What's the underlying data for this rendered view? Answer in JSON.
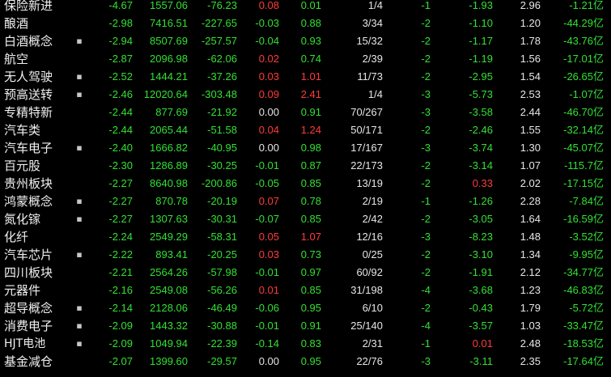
{
  "colors": {
    "up": "#ff3b3b",
    "down": "#33e033",
    "flat": "#e6e6e6",
    "background": "#000000"
  },
  "rows": [
    {
      "name": "保险新进",
      "mark": "",
      "pct": "-4.67",
      "index": "1557.06",
      "change": "-76.23",
      "speed": "0.08",
      "turnover": "0.01",
      "updown": "1/4",
      "lead": "-1",
      "lead_pct": "-1.93",
      "vol_ratio": "2.96",
      "flow": "-1.21",
      "flow_unit": "亿"
    },
    {
      "name": "酿酒",
      "mark": "",
      "pct": "-2.98",
      "index": "7416.51",
      "change": "-227.65",
      "speed": "-0.03",
      "turnover": "0.88",
      "updown": "3/34",
      "lead": "-2",
      "lead_pct": "-1.10",
      "vol_ratio": "1.20",
      "flow": "-44.29",
      "flow_unit": "亿"
    },
    {
      "name": "白酒概念",
      "mark": "▪",
      "pct": "-2.94",
      "index": "8507.69",
      "change": "-257.57",
      "speed": "-0.04",
      "turnover": "0.93",
      "updown": "15/32",
      "lead": "-2",
      "lead_pct": "-1.17",
      "vol_ratio": "1.78",
      "flow": "-43.76",
      "flow_unit": "亿"
    },
    {
      "name": "航空",
      "mark": "",
      "pct": "-2.87",
      "index": "2096.98",
      "change": "-62.06",
      "speed": "0.02",
      "turnover": "0.74",
      "updown": "2/39",
      "lead": "-2",
      "lead_pct": "-1.19",
      "vol_ratio": "1.56",
      "flow": "-17.01",
      "flow_unit": "亿"
    },
    {
      "name": "无人驾驶",
      "mark": "▪",
      "pct": "-2.52",
      "index": "1444.21",
      "change": "-37.26",
      "speed": "0.03",
      "turnover": "1.01",
      "updown": "11/73",
      "lead": "-2",
      "lead_pct": "-2.95",
      "vol_ratio": "1.54",
      "flow": "-26.65",
      "flow_unit": "亿"
    },
    {
      "name": "预高送转",
      "mark": "▪",
      "pct": "-2.46",
      "index": "12020.64",
      "change": "-303.48",
      "speed": "0.09",
      "turnover": "2.41",
      "updown": "1/4",
      "lead": "-3",
      "lead_pct": "-5.73",
      "vol_ratio": "2.53",
      "flow": "-1.07",
      "flow_unit": "亿"
    },
    {
      "name": "专精特新",
      "mark": "",
      "pct": "-2.44",
      "index": "877.69",
      "change": "-21.92",
      "speed": "0.00",
      "turnover": "0.91",
      "updown": "70/267",
      "lead": "-3",
      "lead_pct": "-3.58",
      "vol_ratio": "2.44",
      "flow": "-46.70",
      "flow_unit": "亿"
    },
    {
      "name": "汽车类",
      "mark": "",
      "pct": "-2.44",
      "index": "2065.44",
      "change": "-51.58",
      "speed": "0.04",
      "turnover": "1.24",
      "updown": "50/171",
      "lead": "-2",
      "lead_pct": "-2.46",
      "vol_ratio": "1.55",
      "flow": "-32.14",
      "flow_unit": "亿"
    },
    {
      "name": "汽车电子",
      "mark": "▪",
      "pct": "-2.40",
      "index": "1666.82",
      "change": "-40.95",
      "speed": "0.00",
      "turnover": "0.98",
      "updown": "17/167",
      "lead": "-3",
      "lead_pct": "-3.74",
      "vol_ratio": "1.30",
      "flow": "-45.07",
      "flow_unit": "亿"
    },
    {
      "name": "百元股",
      "mark": "",
      "pct": "-2.30",
      "index": "1286.89",
      "change": "-30.25",
      "speed": "-0.01",
      "turnover": "0.87",
      "updown": "22/173",
      "lead": "-2",
      "lead_pct": "-3.14",
      "vol_ratio": "1.07",
      "flow": "-115.7",
      "flow_unit": "亿"
    },
    {
      "name": "贵州板块",
      "mark": "",
      "pct": "-2.27",
      "index": "8640.98",
      "change": "-200.86",
      "speed": "-0.05",
      "turnover": "0.85",
      "updown": "13/19",
      "lead": "-2",
      "lead_pct": "0.33",
      "vol_ratio": "2.02",
      "flow": "-17.15",
      "flow_unit": "亿"
    },
    {
      "name": "鸿蒙概念",
      "mark": "▪",
      "pct": "-2.27",
      "index": "870.78",
      "change": "-20.19",
      "speed": "0.07",
      "turnover": "0.78",
      "updown": "2/19",
      "lead": "-1",
      "lead_pct": "-1.26",
      "vol_ratio": "2.28",
      "flow": "-7.84",
      "flow_unit": "亿"
    },
    {
      "name": "氮化镓",
      "mark": "▪",
      "pct": "-2.27",
      "index": "1307.63",
      "change": "-30.31",
      "speed": "-0.07",
      "turnover": "0.85",
      "updown": "2/42",
      "lead": "-2",
      "lead_pct": "-3.05",
      "vol_ratio": "1.64",
      "flow": "-16.59",
      "flow_unit": "亿"
    },
    {
      "name": "化纤",
      "mark": "",
      "pct": "-2.24",
      "index": "2549.29",
      "change": "-58.31",
      "speed": "0.05",
      "turnover": "1.07",
      "updown": "12/16",
      "lead": "-3",
      "lead_pct": "-8.23",
      "vol_ratio": "1.48",
      "flow": "-3.52",
      "flow_unit": "亿"
    },
    {
      "name": "汽车芯片",
      "mark": "▪",
      "pct": "-2.22",
      "index": "893.41",
      "change": "-20.25",
      "speed": "0.03",
      "turnover": "0.73",
      "updown": "0/25",
      "lead": "-2",
      "lead_pct": "-3.10",
      "vol_ratio": "1.34",
      "flow": "-9.95",
      "flow_unit": "亿"
    },
    {
      "name": "四川板块",
      "mark": "",
      "pct": "-2.21",
      "index": "2564.26",
      "change": "-57.98",
      "speed": "-0.01",
      "turnover": "0.97",
      "updown": "60/92",
      "lead": "-2",
      "lead_pct": "-1.91",
      "vol_ratio": "2.12",
      "flow": "-34.77",
      "flow_unit": "亿"
    },
    {
      "name": "元器件",
      "mark": "",
      "pct": "-2.16",
      "index": "2549.08",
      "change": "-56.26",
      "speed": "0.01",
      "turnover": "0.85",
      "updown": "31/198",
      "lead": "-4",
      "lead_pct": "-3.68",
      "vol_ratio": "1.23",
      "flow": "-46.83",
      "flow_unit": "亿"
    },
    {
      "name": "超导概念",
      "mark": "▪",
      "pct": "-2.14",
      "index": "2128.06",
      "change": "-46.49",
      "speed": "-0.06",
      "turnover": "0.95",
      "updown": "6/10",
      "lead": "-2",
      "lead_pct": "-0.43",
      "vol_ratio": "1.79",
      "flow": "-5.72",
      "flow_unit": "亿"
    },
    {
      "name": "消费电子",
      "mark": "▪",
      "pct": "-2.09",
      "index": "1443.32",
      "change": "-30.88",
      "speed": "-0.01",
      "turnover": "0.91",
      "updown": "25/140",
      "lead": "-4",
      "lead_pct": "-3.57",
      "vol_ratio": "1.03",
      "flow": "-33.47",
      "flow_unit": "亿"
    },
    {
      "name": "HJT电池",
      "mark": "▪",
      "pct": "-2.09",
      "index": "1049.94",
      "change": "-22.39",
      "speed": "-0.14",
      "turnover": "0.83",
      "updown": "2/31",
      "lead": "-1",
      "lead_pct": "0.01",
      "vol_ratio": "2.48",
      "flow": "-18.53",
      "flow_unit": "亿"
    },
    {
      "name": "基金减仓",
      "mark": "",
      "pct": "-2.07",
      "index": "1399.60",
      "change": "-29.57",
      "speed": "0.00",
      "turnover": "0.95",
      "updown": "22/76",
      "lead": "-3",
      "lead_pct": "-3.11",
      "vol_ratio": "2.35",
      "flow": "-17.64",
      "flow_unit": "亿"
    }
  ]
}
